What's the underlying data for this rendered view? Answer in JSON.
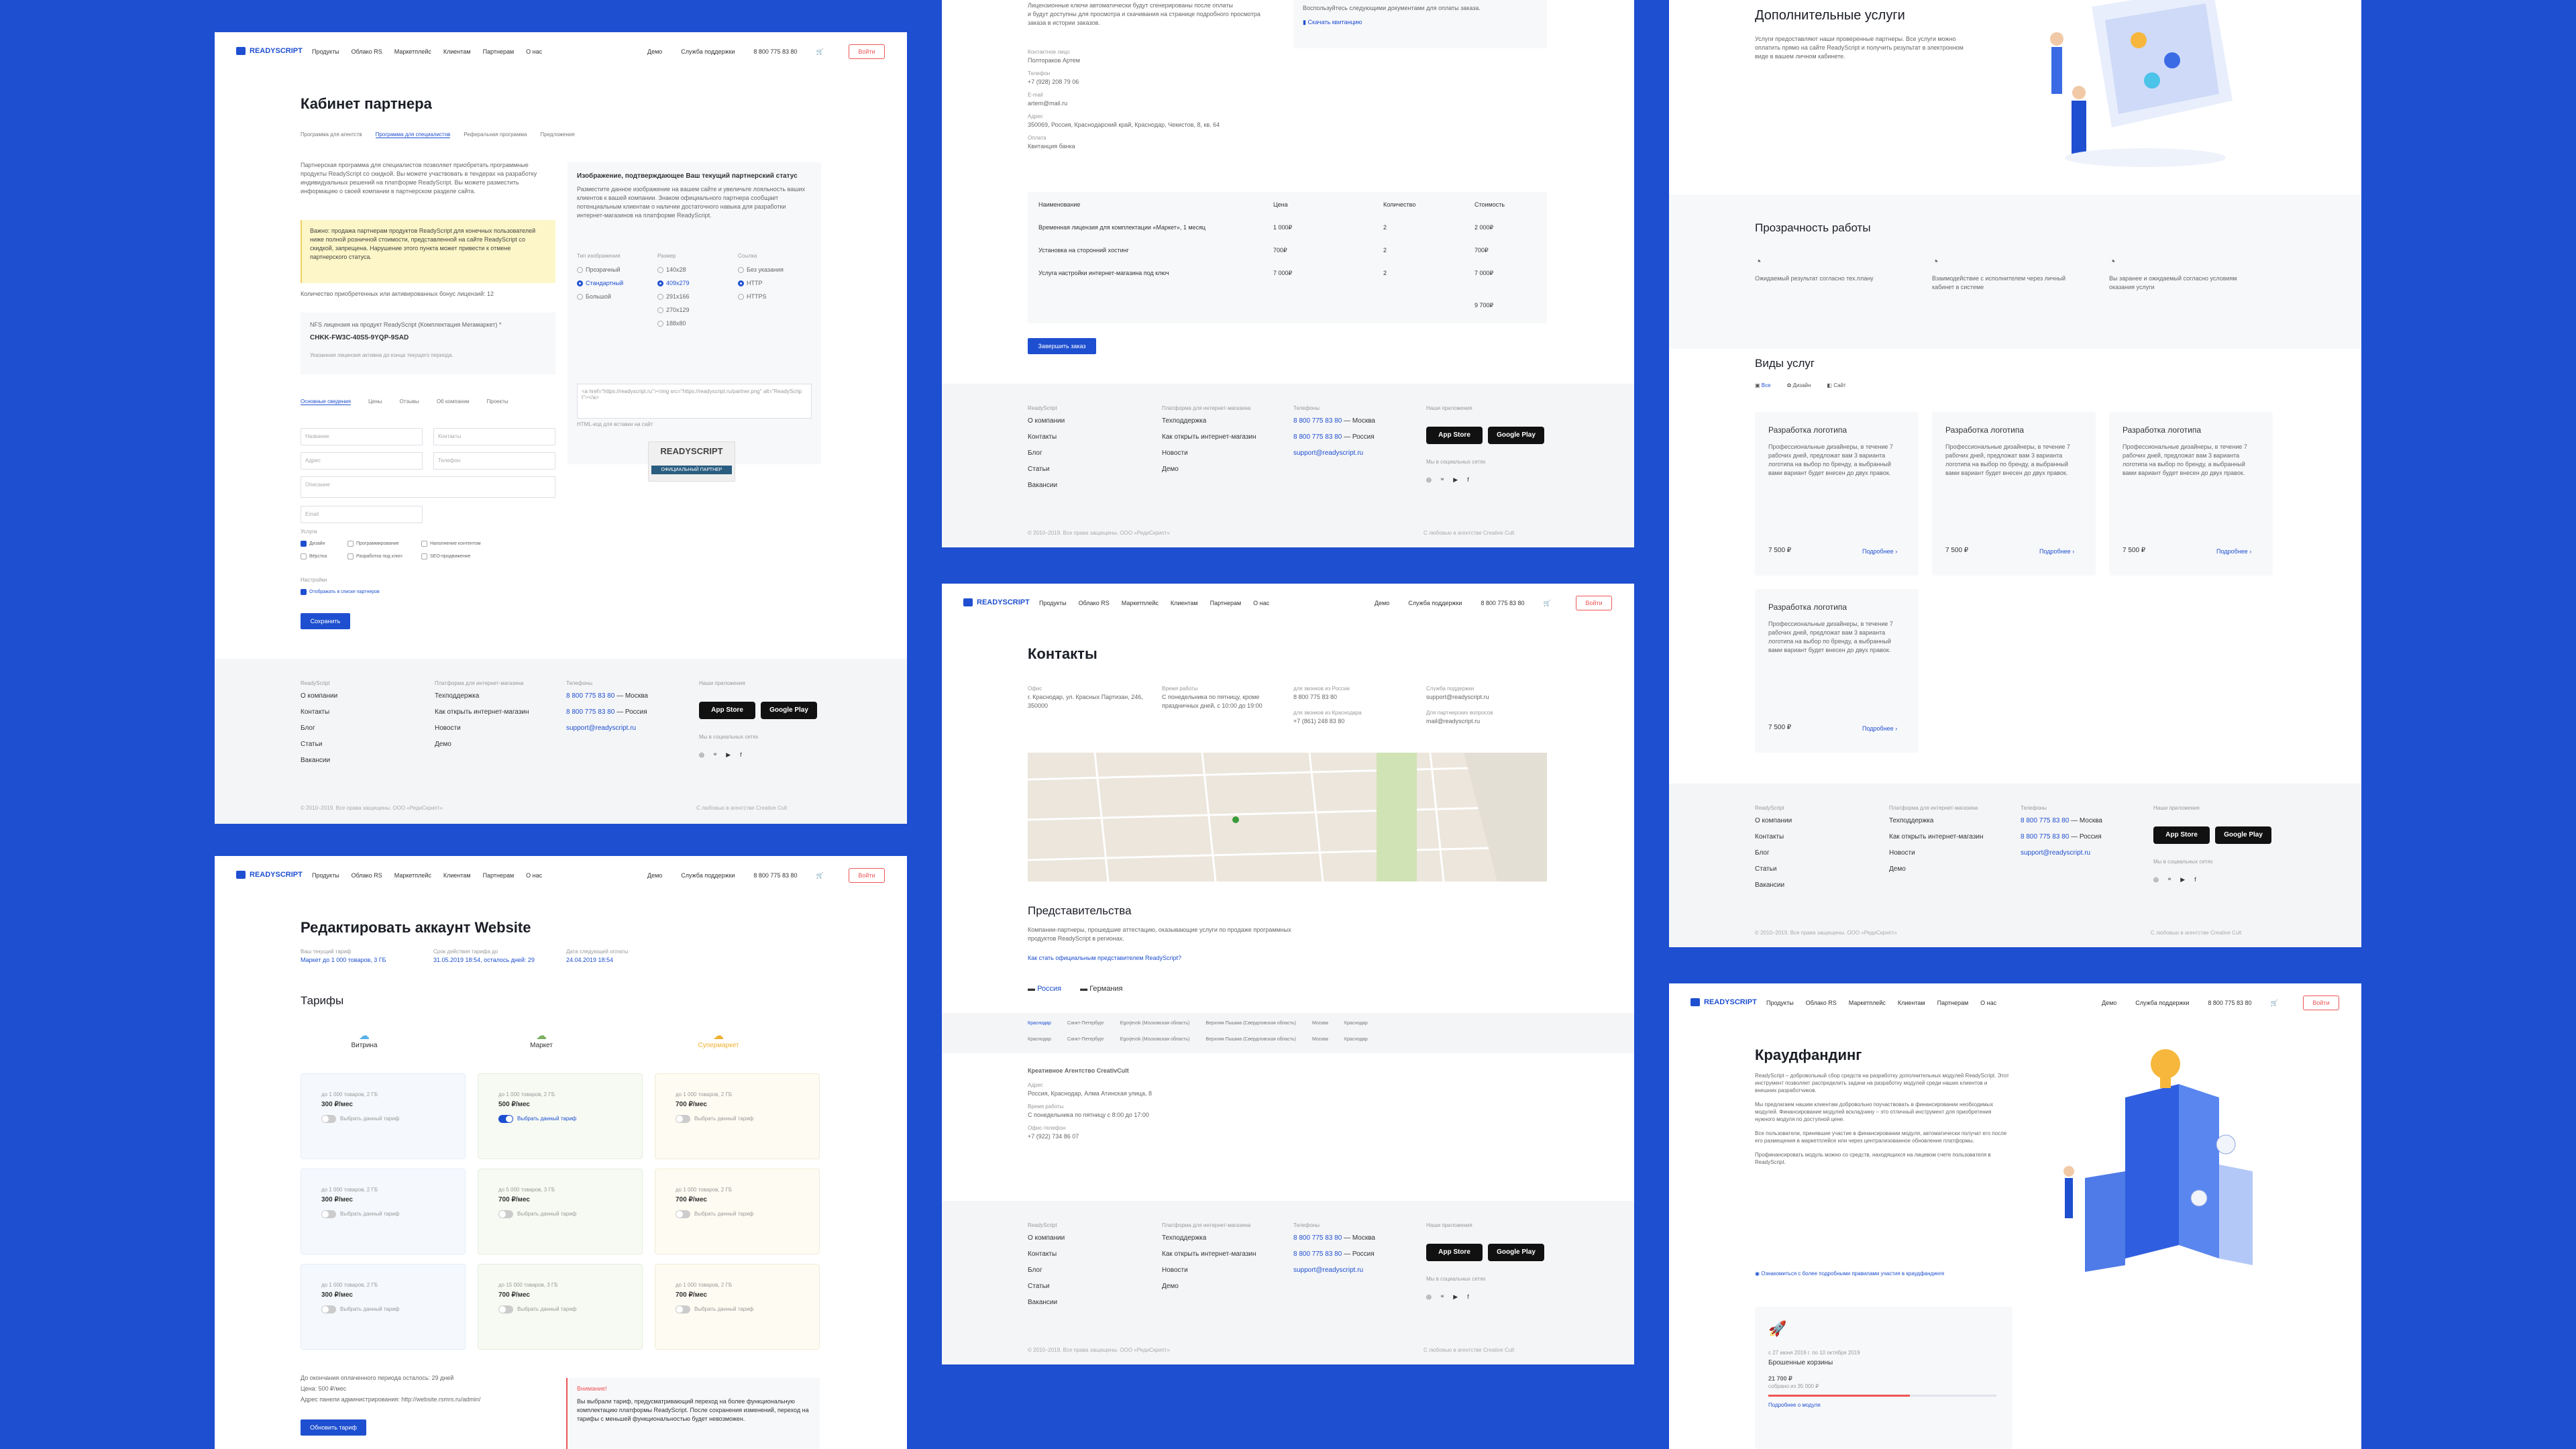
{
  "common": {
    "logo": "READYSCRIPT",
    "nav": [
      "Продукты",
      "Облако RS",
      "Маркетплейс",
      "Клиентам",
      "Партнерам",
      "О нас"
    ],
    "demo": "Демо",
    "support": "Служба поддержки",
    "phone": "8 800 775 83 80",
    "login": "Войти",
    "footer": {
      "c1_title": "ReadyScript",
      "c1": [
        "О компании",
        "Контакты",
        "Блог",
        "Статьи",
        "Вакансии"
      ],
      "c2_title": "Платформа для интернет-магазина",
      "c2": [
        "Техподдержка",
        "Как открыть интернет-магазин",
        "Новости",
        "Демо"
      ],
      "c3_title": "Телефоны",
      "p1": "8 800 775 83 80",
      "p1s": "— Москва",
      "p2": "8 800 775 83 80",
      "p2s": "— Россия",
      "email": "support@readyscript.ru",
      "c4_title": "Наши приложения",
      "app1": "App Store",
      "app2": "Google Play",
      "social_title": "Мы в социальных сетях",
      "copyright": "© 2010–2019. Все права защищены. ООО «РедиСкрипт»",
      "dev": "С любовью в агентстве Creative Cult"
    }
  },
  "p1": {
    "title": "Кабинет партнера",
    "tabs": [
      "Программа для агентств",
      "Программа для специалистов",
      "Реферальная программа",
      "Предложения"
    ],
    "intro": "Партнерская программа для специалистов позволяет приобретать программные продукты ReadyScript со скидкой. Вы можете участвовать в тендерах на разработку индивидуальных решений на платформе ReadyScript. Вы можете разместить информацию о своей компании в партнерском разделе сайта.",
    "note": "Важно: продажа партнерам продуктов ReadyScript для конечных пользователей ниже полной розничной стоимости, представленной на сайте ReadyScript со скидкой, запрещена. Нарушение этого пункта может привести к отмене партнерского статуса.",
    "count_label": "Количество приобретенных или активированных бонус лицензий: 12",
    "license_label": "NFS лицензия на продукт ReadyScript (Комплектация Мегамаркет) *",
    "license_key": "CHKK-FW3C-40S5-9YQP-9SAD",
    "license_note": "Указанная лицензия активна до конца текущего периода.",
    "side_title": "Изображение, подтверждающее Ваш текущий партнерский статус",
    "side_text": "Разместите данное изображение на вашем сайте и увеличьте лояльность ваших клиентов к вашей компании. Знаком официального партнера сообщает потенциальным клиентам о наличии достаточного навыка для разработки интернет-магазинов на платформе ReadyScript.",
    "opt_h": [
      "Тип изображения",
      "Размер",
      "Ссылка"
    ],
    "opt_a": [
      "Прозрачный",
      "Стандартный",
      "Большой"
    ],
    "opt_b": [
      "140x28",
      "409x279",
      "291x166",
      "270x129",
      "188x80"
    ],
    "opt_c": [
      "Без указания",
      "HTTP",
      "HTTPS"
    ],
    "code": "<a href=\"https://readyscript.ru\"><img src=\"https://readyscript.ru/partner.png\" alt=\"ReadyScript\"></a>",
    "code_label": "HTML-код для вставки на сайт",
    "badge_title": "READYSCRIPT",
    "badge_sub": "ОФИЦИАЛЬНЫЙ ПАРТНЕР",
    "form_tabs": [
      "Основные сведения",
      "Цены",
      "Отзывы",
      "Об компании",
      "Проекты"
    ],
    "fields": [
      "Название",
      "Контакты",
      "Адрес",
      "Телефон",
      "Описание",
      "Email"
    ],
    "cb_title": "Услуги",
    "cbs": [
      "Дизайн",
      "Программирование",
      "Наполнение контентом",
      "Вёрстка",
      "Разработка под ключ",
      "SEO-продвижение"
    ],
    "settings_title": "Настройки",
    "show_label": "Отображать в списке партнеров",
    "save": "Сохранить"
  },
  "p2": {
    "lines": [
      "Лицензионные ключи автоматически будут сгенерированы после оплаты",
      "и будут доступны для просмотра и скачивания на странице подробного просмотра",
      "заказа в истории заказов."
    ],
    "side": "Воспользуйтесь следующими документами для оплаты заказа.",
    "side_link": "Скачать квитанцию",
    "info": [
      [
        "Контактное лицо",
        "Полтораков Артем"
      ],
      [
        "Телефон",
        "+7 (928) 208 79 06"
      ],
      [
        "E-mail",
        "artem@mail.ru"
      ],
      [
        "Адрес",
        "350069, Россия, Краснодарский край, Краснодар, Чекистов, 8, кв. 64"
      ],
      [
        "Оплата",
        "Квитанция банка"
      ]
    ],
    "th": [
      "Наименование",
      "Цена",
      "Количество",
      "Стоимость"
    ],
    "rows": [
      [
        "Временная лицензия для комплектации «Маркет», 1 месяц",
        "1 000₽",
        "2",
        "2 000₽"
      ],
      [
        "Установка на сторонний хостинг",
        "700₽",
        "2",
        "700₽"
      ],
      [
        "Услуга настройки интернет-магазина под ключ",
        "7 000₽",
        "2",
        "7 000₽"
      ]
    ],
    "total": "9 700₽",
    "btn": "Завершить заказ"
  },
  "p3": {
    "title": "Дополнительные услуги",
    "text": "Услуги предоставляют наши проверенные партнеры. Все услуги можно оплатить прямо на сайте ReadyScript и получить результат в электронном виде в вашем личном кабинете.",
    "trans_title": "Прозрачность работы",
    "trans": [
      "Ожидаемый результат согласно тех.плану",
      "Взаимодействие с исполнителем через личный кабинет в системе",
      "Вы заранее и ожидаемый согласно условиям оказания услуги"
    ],
    "types_title": "Виды услуг",
    "filters": [
      "Все",
      "Дизайн",
      "Сайт"
    ],
    "svc_title": "Разработка логотипа",
    "svc_text": "Профессиональные дизайнеры, в течение 7 рабочих дней, предложат вам 3 варианта логотипа на выбор по бренду, а выбранный вами вариант будет внесен до двух правок.",
    "svc_price": "7 500 ₽",
    "svc_more": "Подробнее"
  },
  "p4": {
    "title": "Редактировать аккаунт Website",
    "meta": [
      [
        "Ваш текущий тариф",
        "Маркет до 1 000 товаров, 3 ГБ"
      ],
      [
        "Срок действия тарифа до",
        "31.05.2019 18:54, осталось дней: 29"
      ],
      [
        "Дата следующей оплаты",
        "24.04.2019 18:54"
      ]
    ],
    "tariffs_title": "Тарифы",
    "plans": [
      "Витрина",
      "Маркет",
      "Супермаркет"
    ],
    "cards": [
      [
        "до 1 000 товаров, 2 ГБ",
        "300 ₽/мес"
      ],
      [
        "до 1 000 товаров, 2 ГБ",
        "500 ₽/мес"
      ],
      [
        "до 1 000 товаров, 2 ГБ",
        "700 ₽/мес"
      ],
      [
        "до 1 000 товаров, 2 ГБ",
        "300 ₽/мес"
      ],
      [
        "до 5 000 товаров, 3 ГБ",
        "700 ₽/мес"
      ],
      [
        "до 1 000 товаров, 2 ГБ",
        "700 ₽/мес"
      ],
      [
        "до 1 000 товаров, 2 ГБ",
        "300 ₽/мес"
      ],
      [
        "до 15 000 товаров, 3 ГБ",
        "700 ₽/мес"
      ],
      [
        "до 1 000 товаров, 2 ГБ",
        "700 ₽/мес"
      ]
    ],
    "choose": "Выбрать данный тариф",
    "bottom": [
      "До окончания оплаченного периода осталось: 29 дней",
      "Цена: 500 ₽/мес",
      "Адрес панели администрирования: http://website.rsmrs.ru/admin/"
    ],
    "warn_title": "Внимание!",
    "warn": "Вы выбрали тариф, предусматривающий переход на более функциональную комплектацию платформы ReadyScript. После сохранения изменений, переход на тарифы с меньшей функциональностью будет невозможен.",
    "btn": "Обновить тариф"
  },
  "p5": {
    "title": "Контакты",
    "cols": [
      [
        "Офис",
        "г. Краснодар, ул. Красных Партизан, 246, 350000"
      ],
      [
        "Время работы",
        "С понедельника по пятницу, кроме праздничных дней, с 10:00 до 19:00"
      ],
      [
        "для звонков из России",
        "8 800 775 83 80"
      ],
      [
        "Служба поддержки",
        "support@readyscript.ru"
      ]
    ],
    "cols2": [
      [
        "для звонков из Краснодара",
        "+7 (861) 248 83 80"
      ],
      [
        "Для партнерских вопросов",
        "mail@readyscript.ru"
      ]
    ],
    "rep_title": "Представительства",
    "rep_text": "Компании-партнеры, прошедшие аттестацию, оказывающие услуги по продаже программных продуктов ReadyScript в регионах.",
    "rep_link": "Как стать официальным представителем ReadyScript?",
    "countries": [
      "Россия",
      "Германия"
    ],
    "cities1": [
      "Краснодар",
      "Санкт-Петербург",
      "Egorjevsk (Московская область)",
      "Верхняя Пышма (Свердловская область)",
      "Москва",
      "Краснодар"
    ],
    "cities2": [
      "Краснодар",
      "Санкт-Петербург",
      "Egorjevsk (Московская область)",
      "Верхняя Пышма (Свердловская область)",
      "Москва",
      "Краснодар"
    ],
    "agency": "Креативное Агентство CreativCult",
    "ag": [
      [
        "Адрес",
        "Россия, Краснодар, Алма Атинская улица, 8"
      ],
      [
        "Время работы",
        "С понедельника по пятницу с 8:00 до 17:00"
      ],
      [
        "Офис-телефон",
        "+7 (922) 734 86 07"
      ]
    ]
  },
  "p6": {
    "title": "Краудфандинг",
    "paras": [
      "ReadyScript – добровольный сбор средств на разработку дополнительных модулей ReadyScript. Этот инструмент позволяет распределить задачи на разработку модулей среди наших клиентов и внешних разработчиков.",
      "Мы предлагаем нашим клиентам добровольно поучаствовать в финансировании необходимых модулей. Финансирование модулей вскладчину – это отличный инструмент для приобретения нужного модуля по доступной цене.",
      "Все пользователи, принявшие участие в финансировании модуля, автоматически получат его после его размещения в маркетплейсе или через централизованное обновление платформы.",
      "Профинансировать модуль можно со средств, находящихся на лицевом счете пользователя в ReadyScript."
    ],
    "link": "Ознакомиться с более подробными правилами участия в краудфандинге",
    "proj_date": "с 27 июня 2019 г. по 10 октября 2019",
    "proj_name": "Брошенные корзины",
    "proj_sum": "21 700 ₽",
    "proj_sub": "собрано из 35 000 ₽",
    "proj_more": "Подробнее о модуле",
    "progress": 0.62
  }
}
